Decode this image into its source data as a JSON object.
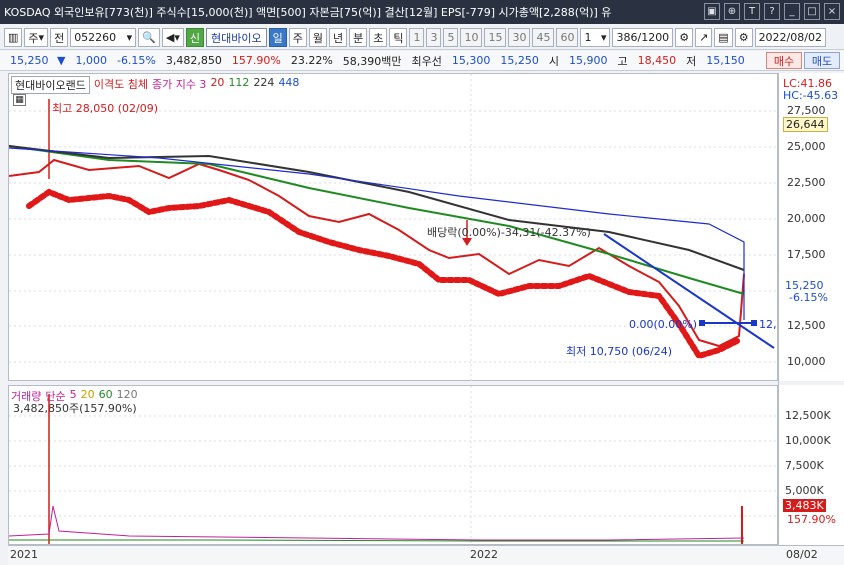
{
  "header": {
    "title": "KOSDAQ 외국인보유[773(천)] 주식수[15,000(천)] 액면[500] 자본금[75(억)] 결산[12월] EPS[-779] 시가총액[2,288(억)] 유",
    "icons": [
      "restore-window-icon",
      "pin-icon",
      "text-size-icon",
      "help-icon",
      "minimize-icon",
      "maximize-icon",
      "close-icon"
    ]
  },
  "toolbar": {
    "code_prefix": "주",
    "period_button": "전",
    "stock_code": "052260",
    "sin_badge": "신",
    "stock_name": "현대바이오",
    "intervals": [
      "일",
      "주",
      "월",
      "년",
      "분",
      "초",
      "틱"
    ],
    "active_interval": "일",
    "numbers": [
      "1",
      "3",
      "5",
      "10",
      "15",
      "30",
      "45",
      "60"
    ],
    "select_value": "1",
    "count_display": "386",
    "count_total": "/1200",
    "date_value": "2022/08/02"
  },
  "quote": {
    "price": "15,250",
    "change": "1,000",
    "change_pct": "-6.15%",
    "volume": "3,482,850",
    "volume_ratio": "157.90%",
    "turnover": "23.22%",
    "amount": "58,390백만",
    "label_priority": "최우선",
    "best_ask": "15,300",
    "best_bid": "15,250",
    "label_open": "시",
    "open": "15,900",
    "label_high": "고",
    "high": "18,450",
    "label_low": "저",
    "low": "15,150",
    "buy_button": "매수",
    "sell_button": "매도"
  },
  "chart": {
    "legend_name": "현대바이오랜드",
    "legend_indicator": "이격도 침체",
    "legend_ma_label": "종가 지수 3",
    "legend_ma": [
      "20",
      "112",
      "224",
      "448"
    ],
    "lc_label": "LC:41.86",
    "hc_label": "HC:-45.63",
    "high_annot": "최고 28,050 (02/09)",
    "low_annot": "최저 10,750 (06/24)",
    "ex_right_annot": "배당락(0.00%)-34,31(-42.37%)",
    "zero_annot": "0.00(0.00%)",
    "right_annot": "12,",
    "cursor_price": "26,644",
    "current_price": "15,250",
    "current_pct": "-6.15%",
    "y_ticks": [
      "27,500",
      "25,000",
      "22,500",
      "20,000",
      "17,500",
      "12,500",
      "10,000"
    ]
  },
  "volume": {
    "legend_label": "거래량",
    "legend_ma_label": "단순",
    "legend_ma": [
      "5",
      "20",
      "60",
      "120"
    ],
    "peak_label": "3,482,850주(157.90%)",
    "y_ticks": [
      "12,500K",
      "10,000K",
      "7,500K",
      "5,000K"
    ],
    "current_vol": "3,483K",
    "current_pct": "157.90%"
  },
  "time_axis": {
    "labels": [
      "2021",
      "2022",
      "08/02"
    ]
  },
  "colors": {
    "candle": "#dc1f1f",
    "ma_gray": "#333333",
    "ma_green": "#1f8a22",
    "ma_blue": "#1e2ccc",
    "ma_red": "#c81818",
    "trend": "#1a37c8"
  }
}
